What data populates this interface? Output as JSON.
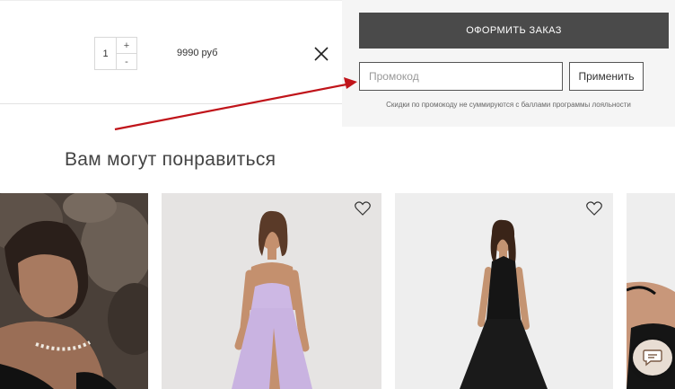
{
  "cart_item": {
    "quantity": "1",
    "plus_label": "+",
    "minus_label": "-",
    "price": "9990 руб"
  },
  "checkout": {
    "checkout_button": "ОФОРМИТЬ ЗАКАЗ",
    "promo_placeholder": "Промокод",
    "promo_value": "",
    "apply_button": "Применить",
    "promo_note": "Скидки по промокоду не суммируются с баллами программы лояльности"
  },
  "recommendations": {
    "title": "Вам могут понравиться",
    "products": [
      {
        "image": "model-with-pearl-necklace"
      },
      {
        "image": "lilac-slit-dress",
        "favorite_icon": "heart-icon"
      },
      {
        "image": "black-halter-dress",
        "favorite_icon": "heart-icon"
      },
      {
        "image": "black-dress-partial"
      }
    ]
  },
  "colors": {
    "checkout_button": "#4a4a4a",
    "panel_bg": "#f5f5f5",
    "annotation_arrow": "#c0141a",
    "chat_bubble": "#e8ddd3"
  },
  "icons": {
    "remove": "close-icon",
    "favorite": "heart-icon",
    "chat": "chat-icon"
  }
}
